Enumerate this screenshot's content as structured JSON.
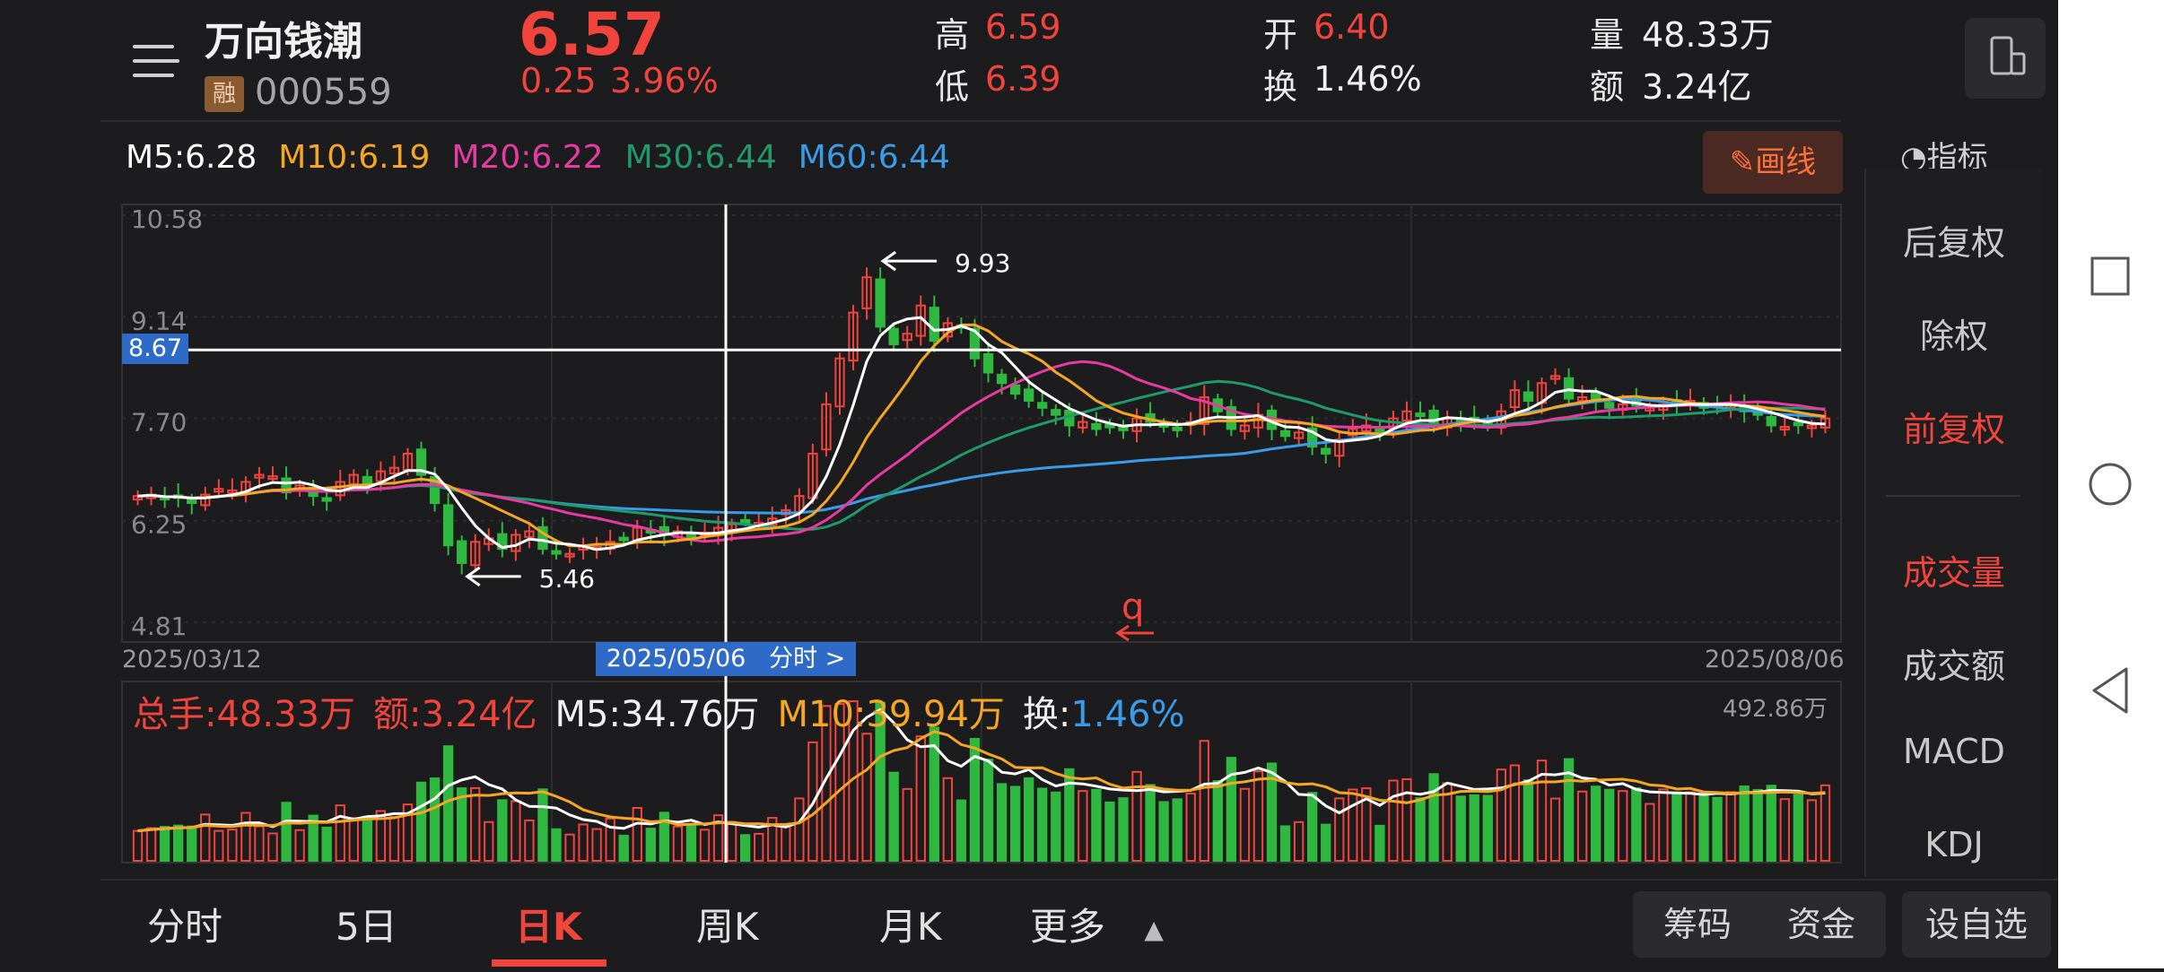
{
  "stock": {
    "name": "万向钱潮",
    "badge": "融",
    "code": "000559",
    "price": "6.57",
    "change": "0.25",
    "change_pct": "3.96%",
    "high_label": "高",
    "high": "6.59",
    "low_label": "低",
    "low": "6.39",
    "open_label": "开",
    "open": "6.40",
    "turnover_label": "换",
    "turnover": "1.46%",
    "volume_label": "量",
    "volume": "48.33万",
    "amount_label": "额",
    "amount": "3.24亿"
  },
  "ma_legend": {
    "m5": "M5:6.28",
    "m10": "M10:6.19",
    "m20": "M20:6.22",
    "m30": "M30:6.44",
    "m60": "M60:6.44",
    "colors": {
      "m5": "#ffffff",
      "m10": "#f5a623",
      "m20": "#e83aa3",
      "m30": "#1f9a6a",
      "m60": "#3a9be8"
    }
  },
  "toolbar": {
    "draw_label": "画线",
    "indicator_label": "指标"
  },
  "side_panel": {
    "items": [
      "后复权",
      "除权",
      "前复权",
      "成交量",
      "成交额",
      "MACD",
      "KDJ"
    ],
    "active": [
      "前复权",
      "成交量"
    ]
  },
  "kchart": {
    "y_ticks": [
      "10.58",
      "9.14",
      "7.70",
      "6.25",
      "4.81"
    ],
    "start_date": "2025/03/12",
    "end_date": "2025/08/06",
    "cursor_date": "2025/05/06",
    "cursor_link": "分时 >",
    "cursor_price": "8.67",
    "high_marker": "9.93",
    "low_marker": "5.46",
    "annotation": "q"
  },
  "volume": {
    "total_label": "总手:48.33万",
    "amount_label": "额:3.24亿",
    "m5_label": "M5:34.76万",
    "m10_label": "M10:39.94万",
    "turn_label": "换:",
    "turn_value": "1.46%",
    "max_label": "492.86万"
  },
  "tabs": [
    "分时",
    "5日",
    "日K",
    "周K",
    "月K",
    "更多"
  ],
  "active_tab": "日K",
  "bottom_buttons": {
    "chips": "筹码",
    "funds": "资金",
    "watchlist": "设自选"
  },
  "chart_data": {
    "type": "candlestick",
    "ylim": [
      4.81,
      10.58
    ],
    "y_ticks": [
      10.58,
      9.14,
      7.7,
      6.25,
      4.81
    ],
    "x_range": [
      "2025/03/12",
      "2025/08/06"
    ],
    "close": [
      6.6,
      6.62,
      6.55,
      6.58,
      6.5,
      6.62,
      6.7,
      6.68,
      6.8,
      6.9,
      6.88,
      6.65,
      6.75,
      6.6,
      6.55,
      6.8,
      6.9,
      6.75,
      6.95,
      7.0,
      7.2,
      6.9,
      6.5,
      5.9,
      5.65,
      5.95,
      6.0,
      5.85,
      6.05,
      6.1,
      5.85,
      5.8,
      5.78,
      5.9,
      5.88,
      5.95,
      6.0,
      6.15,
      6.1,
      6.05,
      6.1,
      6.0,
      6.08,
      6.15,
      6.2,
      6.25,
      6.22,
      6.28,
      6.4,
      6.6,
      7.2,
      7.9,
      8.55,
      9.2,
      9.7,
      9.0,
      8.75,
      8.9,
      9.3,
      8.8,
      9.05,
      9.0,
      8.55,
      8.35,
      8.2,
      8.05,
      7.95,
      7.85,
      7.75,
      7.6,
      7.65,
      7.55,
      7.6,
      7.55,
      7.7,
      7.65,
      7.6,
      7.55,
      7.65,
      8.0,
      7.8,
      7.55,
      7.6,
      7.75,
      7.55,
      7.45,
      7.5,
      7.3,
      7.2,
      7.4,
      7.55,
      7.6,
      7.5,
      7.7,
      7.8,
      7.75,
      7.6,
      7.7,
      7.65,
      7.7,
      7.6,
      7.8,
      8.1,
      7.95,
      8.2,
      8.3,
      7.98,
      8.0,
      7.95,
      7.85,
      7.9,
      7.88,
      7.85,
      7.9,
      7.92,
      7.95,
      7.85,
      7.88,
      7.9,
      7.8,
      7.75,
      7.6,
      7.58,
      7.62,
      7.6,
      7.7
    ],
    "volume_max": 492.86,
    "volume_unit": "万"
  }
}
